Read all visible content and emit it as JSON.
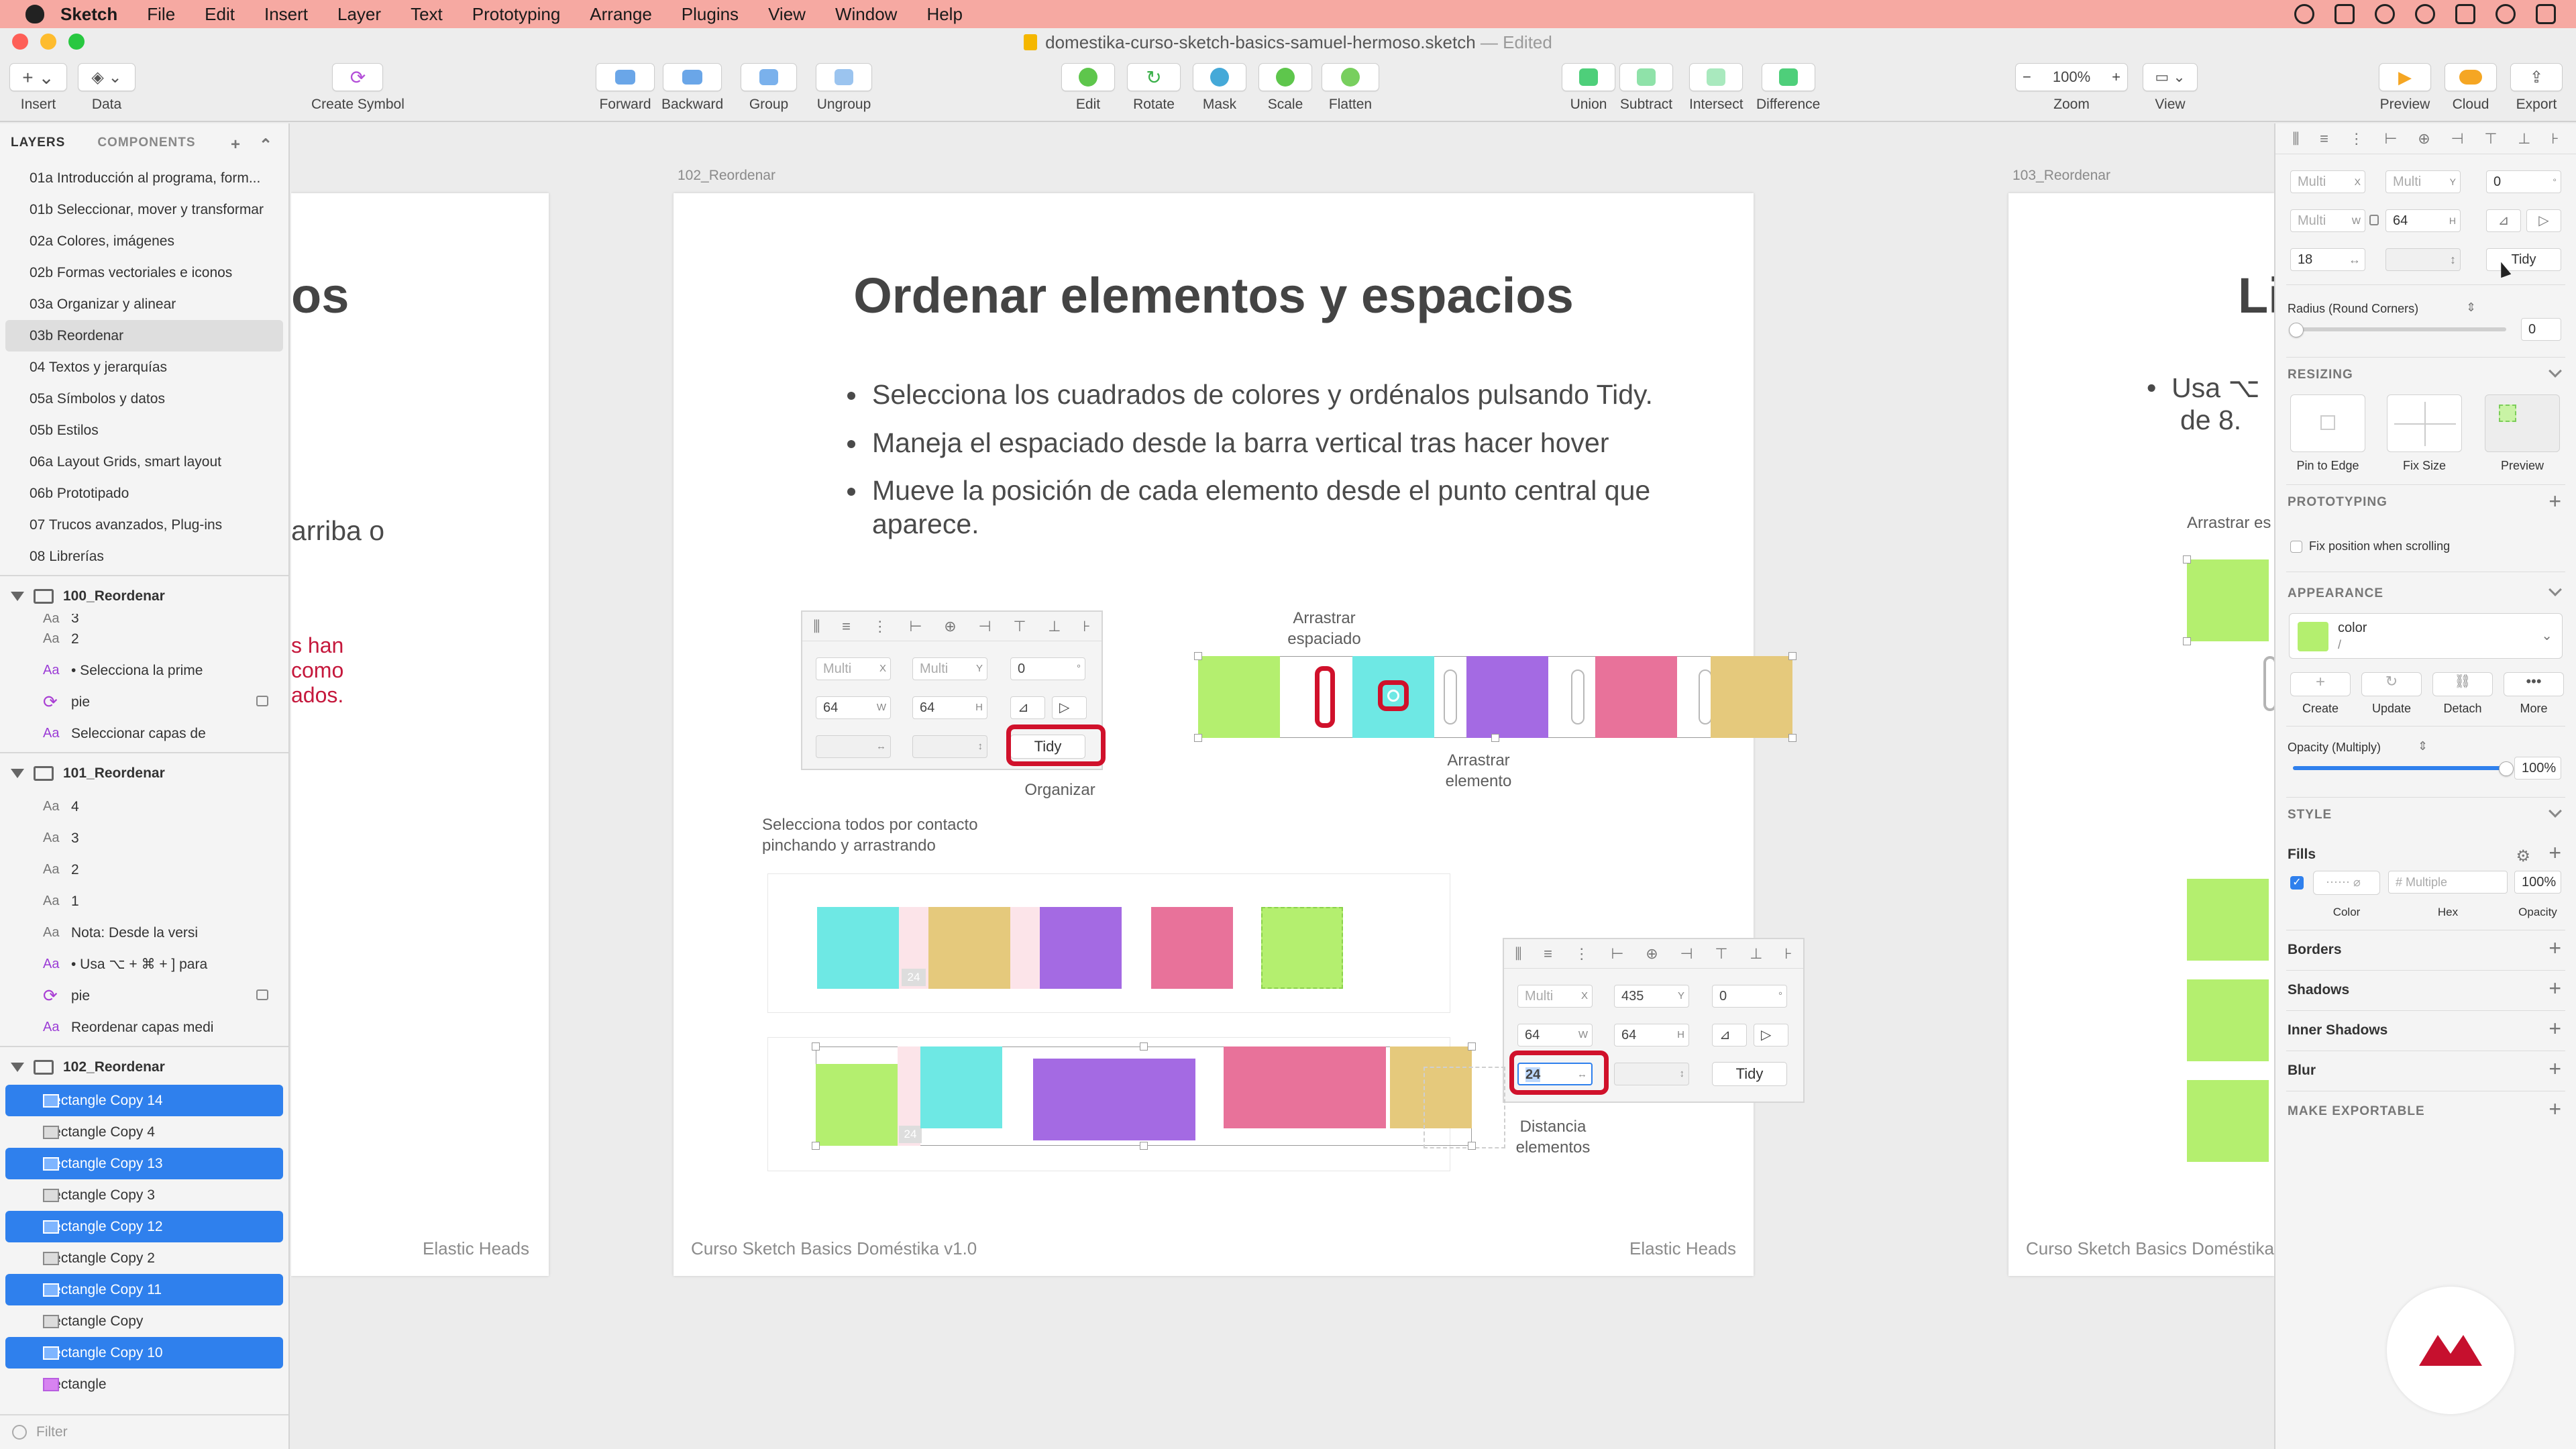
{
  "menubar": {
    "app": "Sketch",
    "items": [
      "File",
      "Edit",
      "Insert",
      "Layer",
      "Text",
      "Prototyping",
      "Arrange",
      "Plugins",
      "View",
      "Window",
      "Help"
    ]
  },
  "window": {
    "title": "domestika-curso-sketch-basics-samuel-hermoso.sketch",
    "edited": "— Edited"
  },
  "toolbar": {
    "insert": "Insert",
    "data": "Data",
    "create_symbol": "Create Symbol",
    "forward": "Forward",
    "backward": "Backward",
    "group": "Group",
    "ungroup": "Ungroup",
    "edit": "Edit",
    "rotate": "Rotate",
    "mask": "Mask",
    "scale": "Scale",
    "flatten": "Flatten",
    "union": "Union",
    "subtract": "Subtract",
    "intersect": "Intersect",
    "difference": "Difference",
    "zoom_value": "100%",
    "zoom": "Zoom",
    "view": "View",
    "preview": "Preview",
    "cloud": "Cloud",
    "export": "Export"
  },
  "layers_panel": {
    "tab_layers": "LAYERS",
    "tab_components": "COMPONENTS",
    "pages": [
      "01a Introducción al programa, form...",
      "01b Seleccionar, mover y transformar",
      "02a Colores, imágenes",
      "02b Formas vectoriales e iconos",
      "03a Organizar y alinear",
      "03b Reordenar",
      "04 Textos y jerarquías",
      "05a Símbolos y datos",
      "05b Estilos",
      "06a Layout Grids, smart layout",
      "06b Prototipado",
      "07 Trucos avanzados, Plug-ins",
      "08 Librerías"
    ],
    "artboard1": {
      "name": "100_Reordenar",
      "layers": [
        "3",
        "2",
        "• Selecciona la prime",
        "pie",
        "Seleccionar capas de"
      ]
    },
    "artboard2": {
      "name": "101_Reordenar",
      "layers": [
        "4",
        "3",
        "2",
        "1",
        "Nota: Desde la versi",
        "• Usa ⌥ + ⌘ + ] para",
        "pie",
        "Reordenar capas medi"
      ]
    },
    "artboard3": {
      "name": "102_Reordenar",
      "layers": [
        "Rectangle Copy 14",
        "Rectangle Copy 4",
        "Rectangle Copy 13",
        "Rectangle Copy 3",
        "Rectangle Copy 12",
        "Rectangle Copy 2",
        "Rectangle Copy 11",
        "Rectangle Copy",
        "Rectangle Copy 10",
        "Rectangle"
      ]
    },
    "filter": "Filter"
  },
  "canvas": {
    "left_ab": {
      "title_frag": "os",
      "text_frag": "arriba o",
      "red_lines": [
        "s han",
        "como",
        "ados."
      ],
      "footer": "Elastic Heads"
    },
    "main_ab": {
      "label": "102_Reordenar",
      "title": "Ordenar elementos y espacios",
      "bullets": [
        "Selecciona los cuadrados de colores y ordénalos pulsando Tidy.",
        "Maneja el espaciado desde la barra vertical tras hacer hover",
        "Mueve la posición de cada elemento desde el punto central que aparece."
      ],
      "cap_organizar": "Organizar",
      "cap_arrastrar_esp": "Arrastrar espaciado",
      "cap_arrastrar_el": "Arrastrar elemento",
      "cap_selecciona": "Selecciona todos por contacto pinchando y arrastrando",
      "cap_distancia": "Distancia elementos",
      "footer_left": "Curso Sketch Basics Doméstika v1.0",
      "footer_right": "Elastic Heads",
      "mock1": {
        "x": "Multi",
        "y": "Multi",
        "rot": "0",
        "w": "64",
        "h": "64",
        "tidy": "Tidy"
      },
      "mock2": {
        "x": "Multi",
        "y": "435",
        "rot": "0",
        "w": "64",
        "h": "64",
        "spacing": "24",
        "tidy": "Tidy"
      },
      "gap_label": "24"
    },
    "right_ab": {
      "label": "103_Reordenar",
      "title_frag": "Li",
      "bullet_frag1": "Usa ⌥",
      "bullet_frag2": "de 8.",
      "cap_frag": "Arrastrar es",
      "footer": "Curso Sketch Basics Doméstika"
    }
  },
  "inspector": {
    "x": "Multi",
    "y": "Multi",
    "rotation": "0",
    "w": "Multi",
    "h": "64",
    "spacing": "18",
    "tidy": "Tidy",
    "radius_label": "Radius (Round Corners)",
    "radius_value": "0",
    "resizing": "RESIZING",
    "pin_to_edge": "Pin to Edge",
    "fix_size": "Fix Size",
    "preview": "Preview",
    "prototyping": "PROTOTYPING",
    "fix_position": "Fix position when scrolling",
    "appearance": "APPEARANCE",
    "style_name": "color",
    "style_sub": "/",
    "create": "Create",
    "update": "Update",
    "detach": "Detach",
    "more": "More",
    "opacity_label": "Opacity (Multiply)",
    "opacity_value": "100%",
    "opacity_fraction": 1.0,
    "style": "STYLE",
    "fills": "Fills",
    "fill_hex": "# Multiple",
    "fill_opacity": "100%",
    "color_lbl": "Color",
    "hex_lbl": "Hex",
    "opacity_lbl": "Opacity",
    "borders": "Borders",
    "shadows": "Shadows",
    "inner_shadows": "Inner Shadows",
    "blur": "Blur",
    "make_exportable": "MAKE EXPORTABLE"
  },
  "colors": {
    "green": "#b4ef6f",
    "cyan": "#6ee8e4",
    "purple": "#a46ae3",
    "pink": "#e8729a",
    "gold": "#e5c97c",
    "selection": "#2f80ed",
    "red": "#d0112b"
  }
}
